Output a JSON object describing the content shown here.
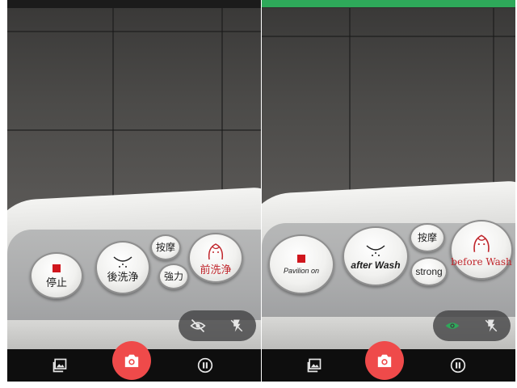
{
  "screens": [
    {
      "state": "original",
      "buttons": {
        "stop": {
          "label": "停止"
        },
        "rear_wash": {
          "label": "後洗浄"
        },
        "massage": {
          "label": "按摩"
        },
        "strong": {
          "label": "強力"
        },
        "front_wash": {
          "label": "前洗浄"
        }
      },
      "overlay_toggle_icon": "eye-off-icon",
      "flash_icon": "flash-off-icon"
    },
    {
      "state": "translated",
      "buttons": {
        "stop": {
          "label": "Pavilion on"
        },
        "rear_wash": {
          "label": "after Wash"
        },
        "massage": {
          "label": "按摩"
        },
        "strong": {
          "label": "strong"
        },
        "front_wash": {
          "label": "before Wash"
        }
      },
      "overlay_toggle_icon": "eye-icon",
      "flash_icon": "flash-off-icon"
    }
  ],
  "bottom_bar": {
    "gallery_icon": "gallery-icon",
    "shutter_icon": "camera-icon",
    "pause_icon": "pause-icon"
  },
  "colors": {
    "active_bar": "#2ea95a",
    "shutter": "#ef4a4a",
    "eye_active": "#2ea95a",
    "stop_red": "#d0161d",
    "label_red": "#c0262c"
  }
}
